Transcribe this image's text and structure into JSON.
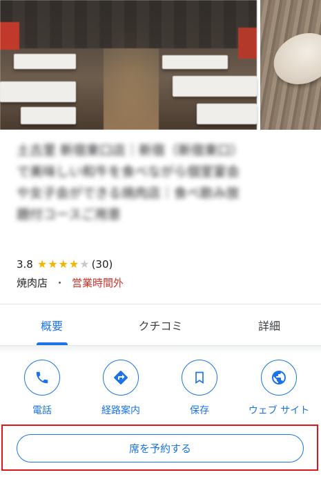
{
  "place": {
    "title": "土古里 新宿東口店｜新宿（新宿東口）で美味しい和牛を食べながら個室宴会や女子会ができる焼肉店｜食べ飲み放題付コースご用意",
    "rating": "3.8",
    "stars_filled": 4,
    "stars_total": 5,
    "review_count": "(30)",
    "category": "焼肉店",
    "separator": "・",
    "status": "営業時間外"
  },
  "tabs": [
    {
      "label": "概要",
      "active": true
    },
    {
      "label": "クチコミ",
      "active": false
    },
    {
      "label": "詳細",
      "active": false
    }
  ],
  "actions": [
    {
      "label": "電話",
      "icon": "phone-icon"
    },
    {
      "label": "経路案内",
      "icon": "directions-icon"
    },
    {
      "label": "保存",
      "icon": "bookmark-icon"
    },
    {
      "label": "ウェブ サイト",
      "icon": "globe-icon"
    }
  ],
  "reserve": {
    "label": "席を予約する"
  },
  "colors": {
    "accent": "#1a73e8",
    "closed": "#d93025",
    "star": "#f5b400",
    "highlight": "#e0131b"
  }
}
